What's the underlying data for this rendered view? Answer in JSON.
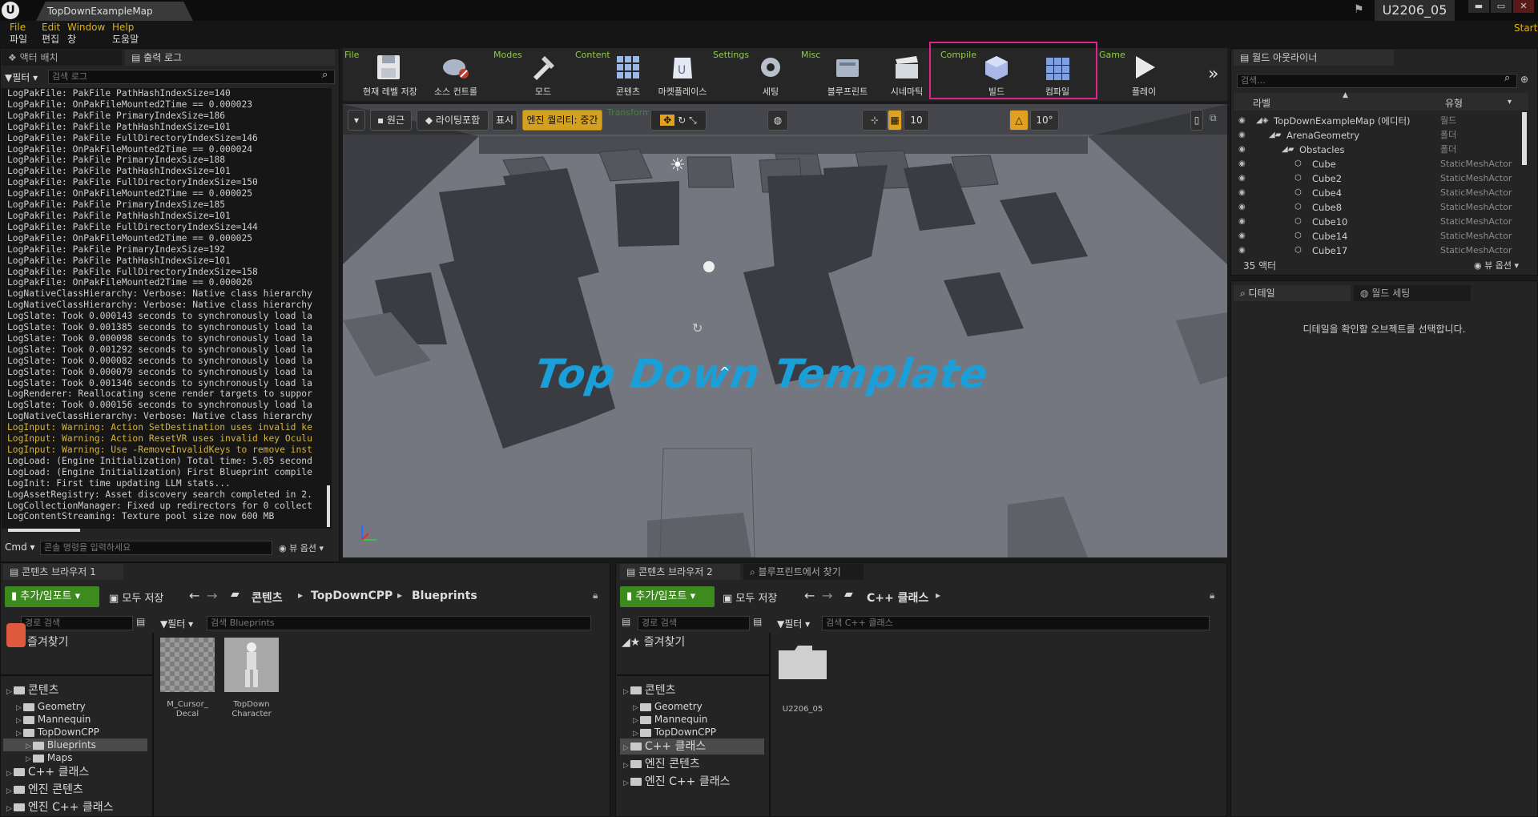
{
  "window": {
    "doc_tab": "TopDownExampleMap",
    "project_name": "U2206_05",
    "controls": {
      "minimize": "▬",
      "maximize": "▭",
      "close": "✕"
    }
  },
  "menu": [
    {
      "en": "File",
      "ko": "파일"
    },
    {
      "en": "Edit",
      "ko": "편집"
    },
    {
      "en": "Window",
      "ko": "창"
    },
    {
      "en": "Help",
      "ko": "도움말"
    }
  ],
  "start_label": "Start",
  "left_panel": {
    "tab_actors": "액터 배치",
    "tab_output": "출력 로그",
    "filter_label": "필터",
    "search_placeholder": "검색 로그",
    "log_lines": [
      {
        "text": "LogPakFile: PakFile PathHashIndexSize=140",
        "warn": false
      },
      {
        "text": "LogPakFile: OnPakFileMounted2Time == 0.000023",
        "warn": false
      },
      {
        "text": "LogPakFile: PakFile PrimaryIndexSize=186",
        "warn": false
      },
      {
        "text": "LogPakFile: PakFile PathHashIndexSize=101",
        "warn": false
      },
      {
        "text": "LogPakFile: PakFile FullDirectoryIndexSize=146",
        "warn": false
      },
      {
        "text": "LogPakFile: OnPakFileMounted2Time == 0.000024",
        "warn": false
      },
      {
        "text": "LogPakFile: PakFile PrimaryIndexSize=188",
        "warn": false
      },
      {
        "text": "LogPakFile: PakFile PathHashIndexSize=101",
        "warn": false
      },
      {
        "text": "LogPakFile: PakFile FullDirectoryIndexSize=150",
        "warn": false
      },
      {
        "text": "LogPakFile: OnPakFileMounted2Time == 0.000025",
        "warn": false
      },
      {
        "text": "LogPakFile: PakFile PrimaryIndexSize=185",
        "warn": false
      },
      {
        "text": "LogPakFile: PakFile PathHashIndexSize=101",
        "warn": false
      },
      {
        "text": "LogPakFile: PakFile FullDirectoryIndexSize=144",
        "warn": false
      },
      {
        "text": "LogPakFile: OnPakFileMounted2Time == 0.000025",
        "warn": false
      },
      {
        "text": "LogPakFile: PakFile PrimaryIndexSize=192",
        "warn": false
      },
      {
        "text": "LogPakFile: PakFile PathHashIndexSize=101",
        "warn": false
      },
      {
        "text": "LogPakFile: PakFile FullDirectoryIndexSize=158",
        "warn": false
      },
      {
        "text": "LogPakFile: OnPakFileMounted2Time == 0.000026",
        "warn": false
      },
      {
        "text": "LogNativeClassHierarchy: Verbose: Native class hierarchy",
        "warn": false
      },
      {
        "text": "LogNativeClassHierarchy: Verbose: Native class hierarchy",
        "warn": false
      },
      {
        "text": "LogSlate: Took 0.000143 seconds to synchronously load la",
        "warn": false
      },
      {
        "text": "LogSlate: Took 0.001385 seconds to synchronously load la",
        "warn": false
      },
      {
        "text": "LogSlate: Took 0.000098 seconds to synchronously load la",
        "warn": false
      },
      {
        "text": "LogSlate: Took 0.001292 seconds to synchronously load la",
        "warn": false
      },
      {
        "text": "LogSlate: Took 0.000082 seconds to synchronously load la",
        "warn": false
      },
      {
        "text": "LogSlate: Took 0.000079 seconds to synchronously load la",
        "warn": false
      },
      {
        "text": "LogSlate: Took 0.001346 seconds to synchronously load la",
        "warn": false
      },
      {
        "text": "LogRenderer: Reallocating scene render targets to suppor",
        "warn": false
      },
      {
        "text": "LogSlate: Took 0.000156 seconds to synchronously load la",
        "warn": false
      },
      {
        "text": "LogNativeClassHierarchy: Verbose: Native class hierarchy",
        "warn": false
      },
      {
        "text": "LogInput: Warning: Action SetDestination uses invalid ke",
        "warn": true
      },
      {
        "text": "LogInput: Warning: Action ResetVR uses invalid key Oculu",
        "warn": true
      },
      {
        "text": "LogInput: Warning: Use -RemoveInvalidKeys to remove inst",
        "warn": true
      },
      {
        "text": "LogLoad: (Engine Initialization) Total time: 5.05 second",
        "warn": false
      },
      {
        "text": "LogLoad: (Engine Initialization) First Blueprint compile",
        "warn": false
      },
      {
        "text": "LogInit: First time updating LLM stats...",
        "warn": false
      },
      {
        "text": "LogAssetRegistry: Asset discovery search completed in 2.",
        "warn": false
      },
      {
        "text": "LogCollectionManager: Fixed up redirectors for 0 collect",
        "warn": false
      },
      {
        "text": "LogContentStreaming: Texture pool size now 600 MB",
        "warn": false
      }
    ],
    "cmd_label": "Cmd",
    "cmd_placeholder": "콘솔 명령을 입력하세요",
    "view_options": "뷰 옵션"
  },
  "toolbar": {
    "sections": [
      "File",
      "Modes",
      "Content",
      "Settings",
      "Misc",
      "Compile",
      "Game"
    ],
    "buttons": [
      {
        "label": "현재 레벨 저장",
        "icon": "save-icon"
      },
      {
        "label": "소스 컨트롤",
        "icon": "source-control-icon"
      },
      {
        "label": "모드",
        "icon": "modes-icon"
      },
      {
        "label": "콘텐츠",
        "icon": "content-icon"
      },
      {
        "label": "마켓플레이스",
        "icon": "marketplace-icon"
      },
      {
        "label": "세팅",
        "icon": "settings-icon"
      },
      {
        "label": "블루프린트",
        "icon": "blueprint-icon"
      },
      {
        "label": "시네마틱",
        "icon": "cinematic-icon"
      },
      {
        "label": "빌드",
        "icon": "build-icon"
      },
      {
        "label": "컴파일",
        "icon": "compile-icon"
      },
      {
        "label": "플레이",
        "icon": "play-icon"
      }
    ],
    "more": "»"
  },
  "viewport": {
    "perspective": "원근",
    "lighting": "라이팅포함",
    "show": "표시",
    "quality": "엔진 퀄리티: 중간",
    "hint_text": "Transform  LocalToWorld  LocationGridSnap  RotationGridSnap  Layer  2DSnap  ScaleGridSnap",
    "grid_value": "10",
    "angle_value": "10°",
    "template_text": "Top Down Template",
    "axis_labels": {
      "z": "z",
      "x": "x",
      "y": "y"
    }
  },
  "outliner": {
    "tab": "월드 아웃라이너",
    "search_placeholder": "검색...",
    "col_label": "라벨",
    "col_type": "유형",
    "rows": [
      {
        "name": "TopDownExampleMap (에디터)",
        "type": "월드",
        "indent": 0
      },
      {
        "name": "ArenaGeometry",
        "type": "폴더",
        "indent": 1
      },
      {
        "name": "Obstacles",
        "type": "폴더",
        "indent": 2
      },
      {
        "name": "Cube",
        "type": "StaticMeshActor",
        "indent": 3
      },
      {
        "name": "Cube2",
        "type": "StaticMeshActor",
        "indent": 3
      },
      {
        "name": "Cube4",
        "type": "StaticMeshActor",
        "indent": 3
      },
      {
        "name": "Cube8",
        "type": "StaticMeshActor",
        "indent": 3
      },
      {
        "name": "Cube10",
        "type": "StaticMeshActor",
        "indent": 3
      },
      {
        "name": "Cube14",
        "type": "StaticMeshActor",
        "indent": 3
      },
      {
        "name": "Cube17",
        "type": "StaticMeshActor",
        "indent": 3
      }
    ],
    "actor_count": "35 액터",
    "view_options": "뷰 옵션"
  },
  "details": {
    "tab_details": "디테일",
    "tab_world": "월드 세팅",
    "empty_message": "디테일을 확인할 오브젝트를 선택합니다."
  },
  "content_browser_1": {
    "tab": "콘텐츠 브라우저 1",
    "add_import": "추가/임포트",
    "save_all": "모두 저장",
    "breadcrumb": [
      "콘텐츠",
      "TopDownCPP",
      "Blueprints"
    ],
    "path_search_placeholder": "경로 검색",
    "filter_label": "필터",
    "asset_search_placeholder": "검색 Blueprints",
    "favorites": "즐겨찾기",
    "tree": [
      {
        "label": "콘텐츠",
        "big": true,
        "indent": 0,
        "selected": false
      },
      {
        "label": "Geometry",
        "big": false,
        "indent": 1,
        "selected": false
      },
      {
        "label": "Mannequin",
        "big": false,
        "indent": 1,
        "selected": false
      },
      {
        "label": "TopDownCPP",
        "big": false,
        "indent": 1,
        "selected": false
      },
      {
        "label": "Blueprints",
        "big": false,
        "indent": 2,
        "selected": true
      },
      {
        "label": "Maps",
        "big": false,
        "indent": 2,
        "selected": false
      },
      {
        "label": "C++ 클래스",
        "big": true,
        "indent": 0,
        "selected": false
      },
      {
        "label": "엔진 콘텐츠",
        "big": true,
        "indent": 0,
        "selected": false
      },
      {
        "label": "엔진 C++ 클래스",
        "big": true,
        "indent": 0,
        "selected": false
      }
    ],
    "assets": [
      {
        "name": "M_Cursor_\nDecal"
      },
      {
        "name": "TopDown\nCharacter"
      }
    ]
  },
  "content_browser_2": {
    "tab": "콘텐츠 브라우저 2",
    "tab_blueprint_search": "블루프린트에서 찾기",
    "add_import": "추가/임포트",
    "save_all": "모두 저장",
    "breadcrumb": [
      "C++ 클래스"
    ],
    "path_search_placeholder": "경로 검색",
    "filter_label": "필터",
    "asset_search_placeholder": "검색 C++ 클래스",
    "favorites": "즐겨찾기",
    "tree": [
      {
        "label": "콘텐츠",
        "big": true,
        "indent": 0,
        "selected": false
      },
      {
        "label": "Geometry",
        "big": false,
        "indent": 1,
        "selected": false
      },
      {
        "label": "Mannequin",
        "big": false,
        "indent": 1,
        "selected": false
      },
      {
        "label": "TopDownCPP",
        "big": false,
        "indent": 1,
        "selected": false
      },
      {
        "label": "C++ 클래스",
        "big": true,
        "indent": 0,
        "selected": true
      },
      {
        "label": "엔진 콘텐츠",
        "big": true,
        "indent": 0,
        "selected": false
      },
      {
        "label": "엔진 C++ 클래스",
        "big": true,
        "indent": 0,
        "selected": false
      }
    ],
    "assets": [
      {
        "name": "U2206_05"
      }
    ]
  },
  "colors": {
    "accent_green": "#3d8a1e",
    "section_label": "#8fcf3f",
    "highlight_box": "#e0248c",
    "warning_log": "#d8b43a",
    "template_text": "#1a9fd8"
  }
}
